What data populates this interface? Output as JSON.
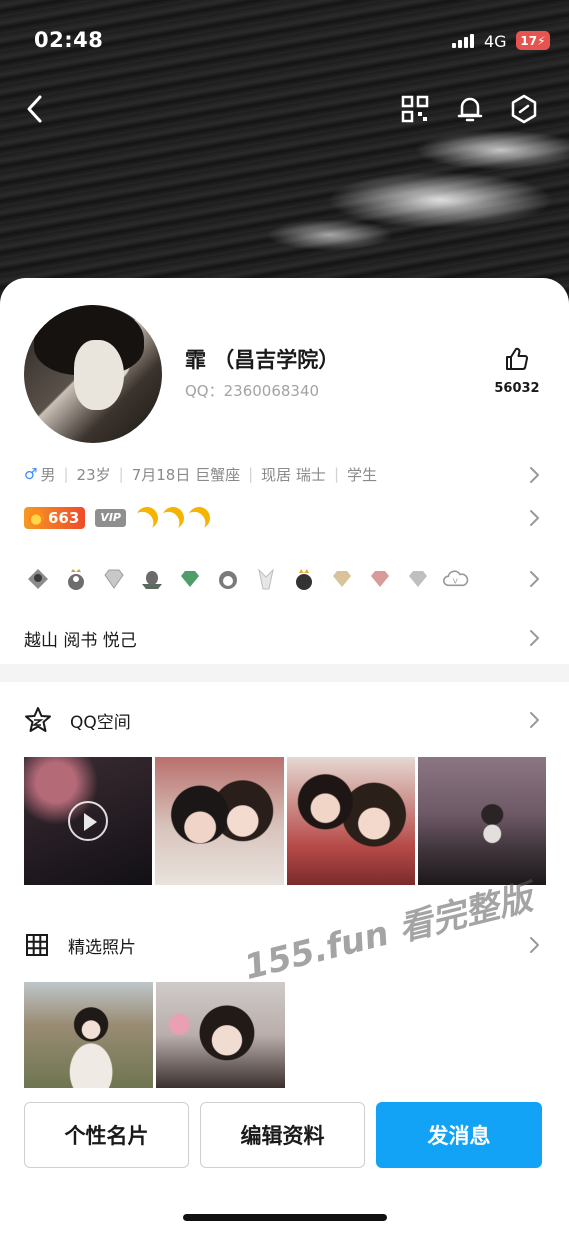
{
  "status_bar": {
    "time": "02:48",
    "network": "4G",
    "battery": "17"
  },
  "header": {
    "back_icon": "back-arrow-icon",
    "qr_icon": "qr-code-icon",
    "bell_icon": "bell-icon",
    "settings_icon": "hexagon-settings-icon"
  },
  "profile": {
    "name": "霏  （昌吉学院）",
    "qq_label": "QQ：2360068340",
    "like_count": "56032",
    "info": {
      "gender_symbol": "♂",
      "gender": "男",
      "age": "23岁",
      "birthday_sign": "7月18日 巨蟹座",
      "residence": "现居 瑞士",
      "occupation": "学生"
    },
    "level": "663",
    "vip_label": "VIP",
    "signature": "越山 阅书 悦己"
  },
  "sections": {
    "qzone": {
      "title": "QQ空间",
      "photos": [
        {
          "kind": "video",
          "tone": "#1f1a24"
        },
        {
          "kind": "photo",
          "tone": "#b98b86"
        },
        {
          "kind": "photo",
          "tone": "#a85c5a"
        },
        {
          "kind": "photo",
          "tone": "#5e4b57"
        }
      ]
    },
    "selected_photos": {
      "title": "精选照片",
      "photos": [
        {
          "kind": "photo",
          "tone": "#a89e88"
        },
        {
          "kind": "photo",
          "tone": "#b39a96"
        }
      ]
    }
  },
  "watermark": "155.fun 看完整版",
  "buttons": {
    "card": "个性名片",
    "edit": "编辑资料",
    "message": "发消息"
  },
  "colors": {
    "accent": "#12a3f7",
    "level_badge": "#ef4a2b",
    "gender_male": "#3d8bff"
  }
}
